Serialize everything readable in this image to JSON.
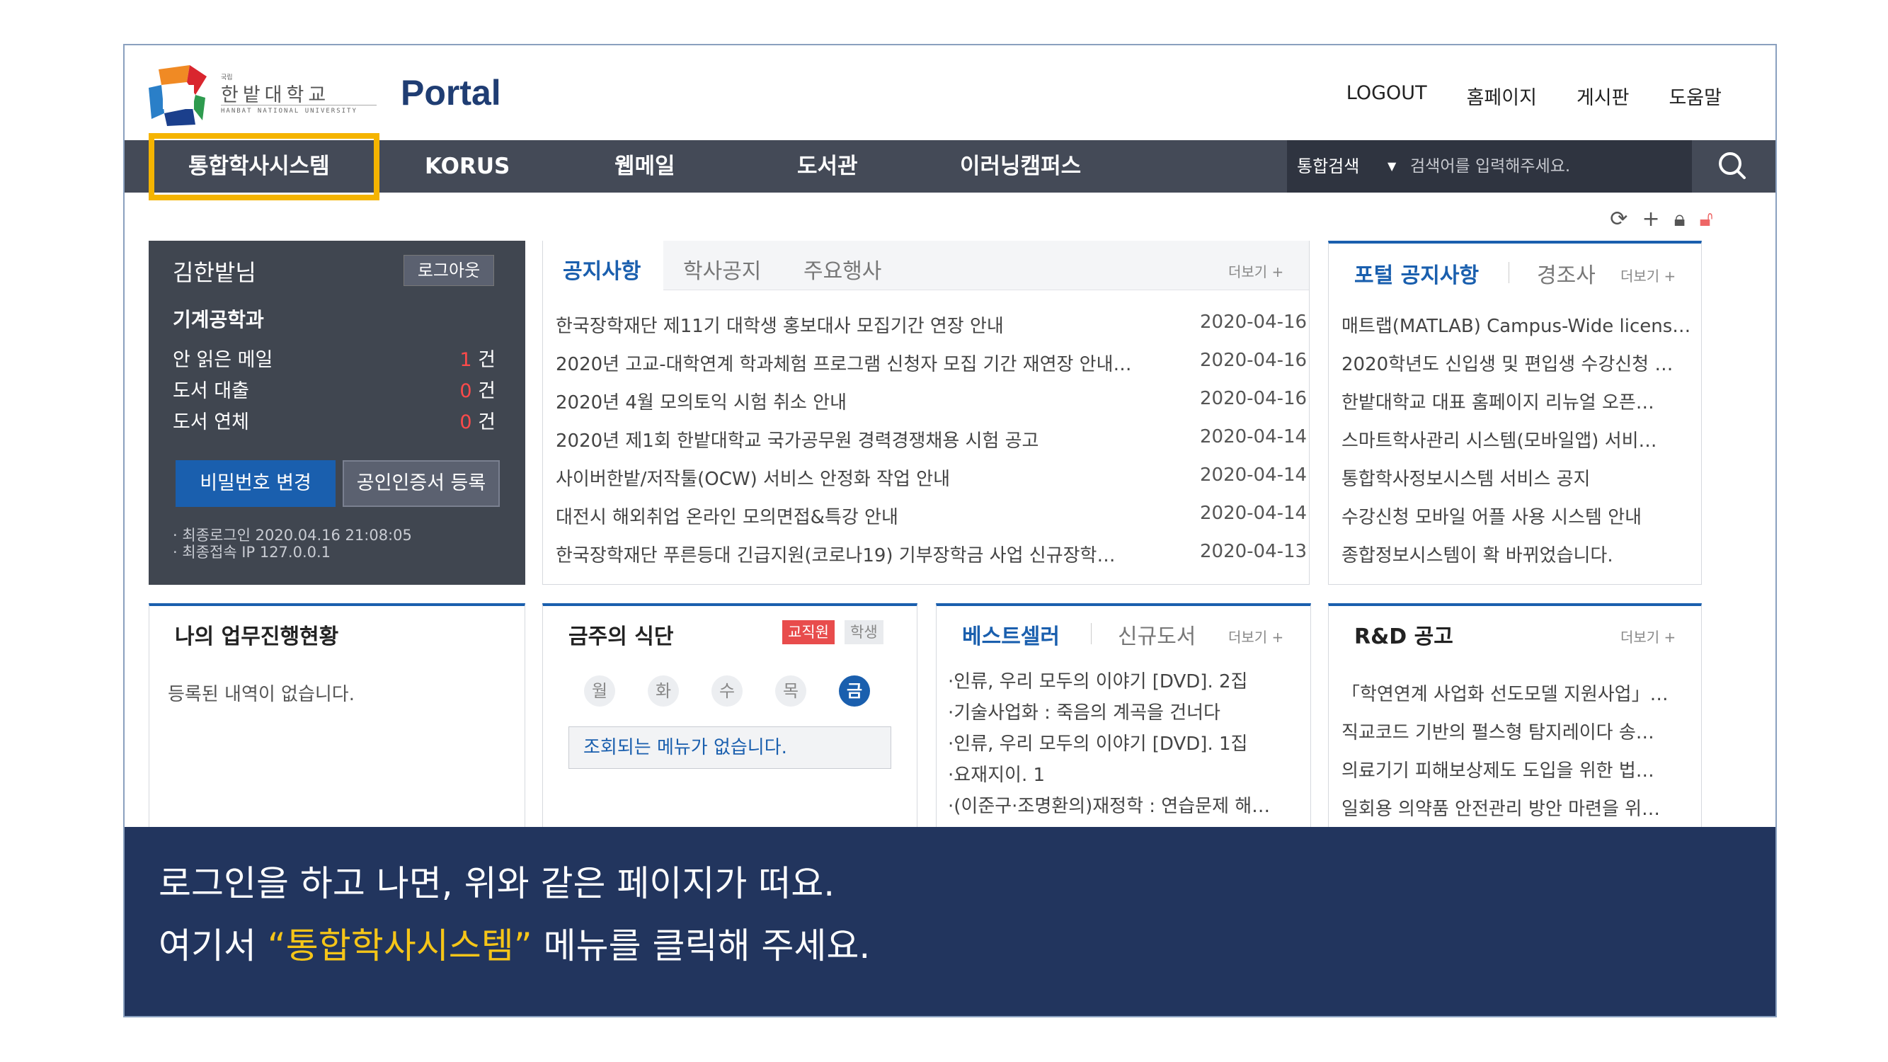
{
  "header": {
    "school_tiny": "국립",
    "school_name": "한밭대학교",
    "school_name_en": "HANBAT NATIONAL UNIVERSITY",
    "portal": "Portal",
    "links": [
      "LOGOUT",
      "홈페이지",
      "게시판",
      "도움말"
    ]
  },
  "nav": {
    "items": [
      "통합학사시스템",
      "KORUS",
      "웹메일",
      "도서관",
      "이러닝캠퍼스"
    ],
    "search_scope": "통합검색",
    "search_placeholder": "검색어를 입력해주세요."
  },
  "colors": {
    "accent": "#1a5fae",
    "highlight": "#f5b400",
    "nav": "#444a57",
    "caption_bg": "#22355e"
  },
  "user": {
    "name": "김한밭님",
    "logout": "로그아웃",
    "department": "기계공학과",
    "stats": [
      {
        "label": "안 읽은 메일",
        "value": "1",
        "unit": "건"
      },
      {
        "label": "도서 대출",
        "value": "0",
        "unit": "건"
      },
      {
        "label": "도서 연체",
        "value": "0",
        "unit": "건"
      }
    ],
    "change_password": "비밀번호 변경",
    "register_cert": "공인인증서 등록",
    "last_login": "· 최종로그인 2020.04.16 21:08:05",
    "last_ip": "· 최종접속 IP 127.0.0.1"
  },
  "notices": {
    "tabs": [
      "공지사항",
      "학사공지",
      "주요행사"
    ],
    "more": "더보기 +",
    "items": [
      {
        "title": "한국장학재단 제11기 대학생 홍보대사 모집기간 연장 안내",
        "date": "2020-04-16"
      },
      {
        "title": "2020년 고교-대학연계 학과체험 프로그램 신청자 모집 기간 재연장 안내…",
        "date": "2020-04-16"
      },
      {
        "title": "2020년 4월 모의토익 시험 취소 안내",
        "date": "2020-04-16"
      },
      {
        "title": "2020년 제1회 한밭대학교 국가공무원 경력경쟁채용 시험 공고",
        "date": "2020-04-14"
      },
      {
        "title": "사이버한밭/저작툴(OCW) 서비스 안정화 작업 안내",
        "date": "2020-04-14"
      },
      {
        "title": "대전시 해외취업 온라인 모의면접&특강 안내",
        "date": "2020-04-14"
      },
      {
        "title": "한국장학재단 푸른등대 긴급지원(코로나19) 기부장학금 사업 신규장학…",
        "date": "2020-04-13"
      }
    ]
  },
  "portal_notices": {
    "tabs": [
      "포털 공지사항",
      "경조사"
    ],
    "more": "더보기 +",
    "items": [
      "매트랩(MATLAB) Campus-Wide licens…",
      "2020학년도 신입생 및 편입생 수강신청 …",
      "한밭대학교 대표 홈페이지 리뉴얼 오픈…",
      "스마트학사관리 시스템(모바일앱) 서비…",
      "통합학사정보시스템 서비스 공지",
      "수강신청 모바일 어플 사용 시스템 안내",
      "종합정보시스템이 확 바뀌었습니다."
    ]
  },
  "work_status": {
    "title": "나의 업무진행현황",
    "empty": "등록된 내역이 없습니다."
  },
  "cafeteria": {
    "title": "금주의 식단",
    "tab_staff": "교직원",
    "tab_student": "학생",
    "days": [
      "월",
      "화",
      "수",
      "목",
      "금"
    ],
    "empty": "조회되는 메뉴가 없습니다."
  },
  "books": {
    "tabs": [
      "베스트셀러",
      "신규도서"
    ],
    "more": "더보기 +",
    "items": [
      "·인류, 우리 모두의 이야기 [DVD]. 2집",
      "·기술사업화 : 죽음의 계곡을 건너다",
      "·인류, 우리 모두의 이야기 [DVD]. 1집",
      "·요재지이. 1",
      "·(이준구·조명환의)재정학 : 연습문제 해…"
    ]
  },
  "rnd": {
    "title": "R&D 공고",
    "more": "더보기 +",
    "items": [
      "「학연연계 사업화 선도모델 지원사업」…",
      "직교코드 기반의 펄스형 탐지레이다 송…",
      "의료기기 피해보상제도 도입을 위한 법…",
      "일회용 의약품 안전관리 방안 마련을 위…"
    ]
  },
  "caption": {
    "line1": "로그인을 하고 나면, 위와 같은 페이지가 떠요.",
    "line2_prefix": "여기서 ",
    "line2_highlight": "“통합학사시스템”",
    "line2_suffix": " 메뉴를 클릭해 주세요."
  }
}
